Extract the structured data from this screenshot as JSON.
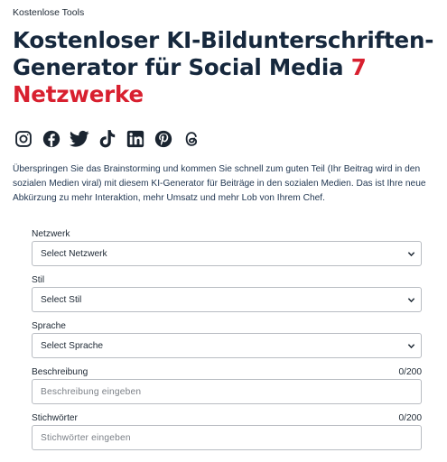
{
  "breadcrumb": {
    "label": "Kostenlose Tools"
  },
  "title": {
    "main": "Kostenloser KI-Bildunterschriften-Generator für Social Media",
    "accent": "7 Netzwerke"
  },
  "social_icons": [
    "instagram-icon",
    "facebook-icon",
    "twitter-icon",
    "tiktok-icon",
    "linkedin-icon",
    "pinterest-icon",
    "threads-icon"
  ],
  "intro": "Überspringen Sie das Brainstorming und kommen Sie schnell zum guten Teil (Ihr Beitrag wird in den sozialen Medien viral) mit diesem KI-Generator für Beiträge in den sozialen Medien. Das ist Ihre neue Abkürzung zu mehr Interaktion, mehr Umsatz und mehr Lob von Ihrem Chef.",
  "form": {
    "network": {
      "label": "Netzwerk",
      "selected": "Select Netzwerk"
    },
    "style": {
      "label": "Stil",
      "selected": "Select Stil"
    },
    "language": {
      "label": "Sprache",
      "selected": "Select Sprache"
    },
    "description": {
      "label": "Beschreibung",
      "counter": "0/200",
      "placeholder": "Beschreibung eingeben"
    },
    "keywords": {
      "label": "Stichwörter",
      "counter": "0/200",
      "placeholder": "Stichwörter eingeben"
    }
  },
  "colors": {
    "title": "#16283d",
    "accent": "#d8202f",
    "border": "#b8bcc2"
  }
}
